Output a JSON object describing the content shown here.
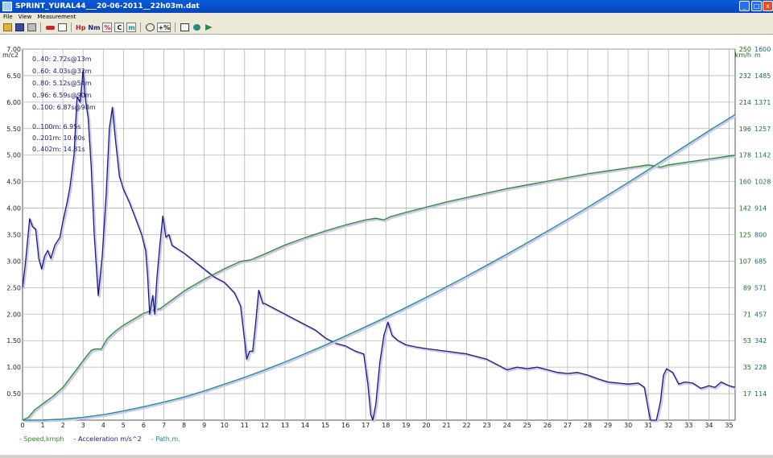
{
  "window": {
    "title": "SPRINT_YURAL44___20-06-2011__22h03m.dat",
    "min_glyph": "_",
    "max_glyph": "□",
    "close_glyph": "x"
  },
  "menu": {
    "file": "File",
    "view": "View",
    "measurement": "Measurement"
  },
  "toolbar": {
    "hp": "Hp",
    "nm": "Nm",
    "percent": "%",
    "c": "C",
    "m": "m",
    "plus_percent": "+%"
  },
  "chart_data": {
    "type": "line",
    "x_ticks": [
      0,
      1,
      2,
      3,
      4,
      5,
      6,
      7,
      8,
      9,
      10,
      11,
      12,
      13,
      14,
      15,
      16,
      17,
      18,
      19,
      20,
      21,
      22,
      23,
      24,
      25,
      26,
      27,
      28,
      29,
      30,
      31,
      32,
      33,
      34,
      35
    ],
    "xlim": [
      0,
      35.3
    ],
    "left_axis": {
      "unit": "m/c2",
      "ylim": [
        0,
        7.0
      ],
      "ticks": [
        "0.50",
        "1.00",
        "1.50",
        "2.00",
        "2.50",
        "3.00",
        "3.50",
        "4.00",
        "4.50",
        "5.00",
        "5.50",
        "6.00",
        "6.50",
        "7.00"
      ]
    },
    "speed_axis": {
      "unit": "km/h",
      "ylim": [
        0,
        250
      ],
      "ticks": [
        {
          "v": 17.857,
          "label": "17"
        },
        {
          "v": 35.714,
          "label": "35"
        },
        {
          "v": 53.571,
          "label": "53"
        },
        {
          "v": 71.429,
          "label": "71"
        },
        {
          "v": 89.286,
          "label": "89"
        },
        {
          "v": 107.143,
          "label": "107"
        },
        {
          "v": 125,
          "label": "125"
        },
        {
          "v": 142.857,
          "label": "142"
        },
        {
          "v": 160.714,
          "label": "160"
        },
        {
          "v": 178.571,
          "label": "178"
        },
        {
          "v": 196.429,
          "label": "196"
        },
        {
          "v": 214.286,
          "label": "214"
        },
        {
          "v": 232.143,
          "label": "232"
        },
        {
          "v": 250,
          "label": "250"
        }
      ]
    },
    "path_axis": {
      "unit": "m",
      "ylim": [
        0,
        1600
      ],
      "ticks": [
        {
          "v": 114.3,
          "label": "114"
        },
        {
          "v": 228.6,
          "label": "228"
        },
        {
          "v": 342.9,
          "label": "342"
        },
        {
          "v": 457.1,
          "label": "457"
        },
        {
          "v": 571.4,
          "label": "571"
        },
        {
          "v": 685.7,
          "label": "685"
        },
        {
          "v": 800,
          "label": "800"
        },
        {
          "v": 914.3,
          "label": "914"
        },
        {
          "v": 1028.6,
          "label": "1028"
        },
        {
          "v": 1142.9,
          "label": "1142"
        },
        {
          "v": 1257.1,
          "label": "1257"
        },
        {
          "v": 1371.4,
          "label": "1371"
        },
        {
          "v": 1485.7,
          "label": "1485"
        },
        {
          "v": 1600,
          "label": "1600"
        }
      ]
    },
    "annotations": [
      "0..40: 2.72s@13m",
      "0..60: 4.03s@32m",
      "0..80: 5.12s@54m",
      "0..96: 6.59s@90m",
      "0..100: 6.87s@98m",
      "0..100m: 6.95s",
      "0..201m: 10.00s",
      "0..402m: 14.81s"
    ],
    "series": [
      {
        "name": "Speed,kmph",
        "axis": "speed",
        "color": "#2e8b22",
        "points": [
          [
            0,
            0
          ],
          [
            0.3,
            2
          ],
          [
            0.6,
            7
          ],
          [
            1,
            11
          ],
          [
            1.5,
            16
          ],
          [
            2,
            22
          ],
          [
            2.5,
            31
          ],
          [
            3,
            40
          ],
          [
            3.4,
            47
          ],
          [
            3.6,
            48
          ],
          [
            3.9,
            48
          ],
          [
            4.2,
            55
          ],
          [
            4.6,
            60
          ],
          [
            5,
            64
          ],
          [
            5.5,
            68
          ],
          [
            6,
            72
          ],
          [
            6.4,
            74
          ],
          [
            6.8,
            75
          ],
          [
            7,
            77
          ],
          [
            7.5,
            82
          ],
          [
            8,
            87
          ],
          [
            9,
            95
          ],
          [
            10,
            102
          ],
          [
            10.8,
            107
          ],
          [
            11.3,
            108
          ],
          [
            12,
            112
          ],
          [
            13,
            118
          ],
          [
            14,
            123
          ],
          [
            15,
            127.5
          ],
          [
            16,
            131.5
          ],
          [
            17,
            135
          ],
          [
            17.5,
            136
          ],
          [
            17.9,
            135
          ],
          [
            18.2,
            137
          ],
          [
            19,
            140
          ],
          [
            20,
            143.5
          ],
          [
            21,
            147
          ],
          [
            22,
            150
          ],
          [
            23,
            153
          ],
          [
            24,
            156
          ],
          [
            25,
            158.5
          ],
          [
            26,
            161
          ],
          [
            27,
            163.5
          ],
          [
            28,
            166
          ],
          [
            29,
            168
          ],
          [
            30,
            170
          ],
          [
            31,
            172
          ],
          [
            31.6,
            170.5
          ],
          [
            32,
            172
          ],
          [
            33,
            174
          ],
          [
            34,
            176
          ],
          [
            35,
            178
          ],
          [
            35.3,
            178.5
          ]
        ]
      },
      {
        "name": "Acceleration m/s^2",
        "axis": "left",
        "color": "#1c1c6e",
        "points": [
          [
            0,
            2.5
          ],
          [
            0.15,
            3.0
          ],
          [
            0.35,
            3.8
          ],
          [
            0.5,
            3.65
          ],
          [
            0.65,
            3.6
          ],
          [
            0.8,
            3.05
          ],
          [
            0.95,
            2.85
          ],
          [
            1.1,
            3.1
          ],
          [
            1.25,
            3.2
          ],
          [
            1.4,
            3.05
          ],
          [
            1.6,
            3.3
          ],
          [
            1.85,
            3.45
          ],
          [
            2,
            3.75
          ],
          [
            2.2,
            4.1
          ],
          [
            2.35,
            4.4
          ],
          [
            2.55,
            5.0
          ],
          [
            2.7,
            6.1
          ],
          [
            2.85,
            6.0
          ],
          [
            3.0,
            6.6
          ],
          [
            3.1,
            6.1
          ],
          [
            3.25,
            5.7
          ],
          [
            3.4,
            4.8
          ],
          [
            3.55,
            3.5
          ],
          [
            3.75,
            2.35
          ],
          [
            3.95,
            3.1
          ],
          [
            4.15,
            4.3
          ],
          [
            4.3,
            5.5
          ],
          [
            4.45,
            5.9
          ],
          [
            4.6,
            5.3
          ],
          [
            4.8,
            4.6
          ],
          [
            5.0,
            4.35
          ],
          [
            5.3,
            4.1
          ],
          [
            5.6,
            3.8
          ],
          [
            5.9,
            3.5
          ],
          [
            6.1,
            3.2
          ],
          [
            6.2,
            2.7
          ],
          [
            6.3,
            2.0
          ],
          [
            6.45,
            2.35
          ],
          [
            6.55,
            2.0
          ],
          [
            6.65,
            2.65
          ],
          [
            6.8,
            3.3
          ],
          [
            6.95,
            3.85
          ],
          [
            7.1,
            3.45
          ],
          [
            7.25,
            3.5
          ],
          [
            7.4,
            3.3
          ],
          [
            7.6,
            3.25
          ],
          [
            8,
            3.15
          ],
          [
            8.5,
            3.0
          ],
          [
            9,
            2.85
          ],
          [
            9.5,
            2.7
          ],
          [
            10,
            2.6
          ],
          [
            10.5,
            2.4
          ],
          [
            10.8,
            2.15
          ],
          [
            11.0,
            1.5
          ],
          [
            11.1,
            1.15
          ],
          [
            11.25,
            1.3
          ],
          [
            11.4,
            1.3
          ],
          [
            11.55,
            1.85
          ],
          [
            11.7,
            2.45
          ],
          [
            11.9,
            2.2
          ],
          [
            12,
            2.2
          ],
          [
            13,
            2.0
          ],
          [
            13.5,
            1.9
          ],
          [
            14,
            1.8
          ],
          [
            14.5,
            1.7
          ],
          [
            15,
            1.55
          ],
          [
            15.5,
            1.45
          ],
          [
            16,
            1.4
          ],
          [
            16.5,
            1.3
          ],
          [
            16.9,
            1.25
          ],
          [
            17.1,
            0.7
          ],
          [
            17.25,
            0.1
          ],
          [
            17.35,
            0.0
          ],
          [
            17.5,
            0.3
          ],
          [
            17.7,
            1.1
          ],
          [
            17.9,
            1.6
          ],
          [
            18.1,
            1.85
          ],
          [
            18.3,
            1.6
          ],
          [
            18.6,
            1.5
          ],
          [
            19,
            1.42
          ],
          [
            19.5,
            1.38
          ],
          [
            20,
            1.35
          ],
          [
            21,
            1.3
          ],
          [
            22,
            1.25
          ],
          [
            22.5,
            1.2
          ],
          [
            23,
            1.15
          ],
          [
            23.5,
            1.05
          ],
          [
            24,
            0.95
          ],
          [
            24.5,
            1.0
          ],
          [
            25,
            0.97
          ],
          [
            25.5,
            1.0
          ],
          [
            26,
            0.95
          ],
          [
            26.5,
            0.9
          ],
          [
            27,
            0.88
          ],
          [
            27.5,
            0.9
          ],
          [
            28,
            0.85
          ],
          [
            28.5,
            0.78
          ],
          [
            29,
            0.72
          ],
          [
            29.5,
            0.7
          ],
          [
            30,
            0.68
          ],
          [
            30.5,
            0.7
          ],
          [
            30.8,
            0.62
          ],
          [
            31.0,
            0.2
          ],
          [
            31.1,
            0.0
          ],
          [
            31.4,
            0.0
          ],
          [
            31.6,
            0.35
          ],
          [
            31.75,
            0.85
          ],
          [
            31.9,
            0.97
          ],
          [
            32.2,
            0.9
          ],
          [
            32.5,
            0.68
          ],
          [
            32.8,
            0.72
          ],
          [
            33.2,
            0.7
          ],
          [
            33.6,
            0.6
          ],
          [
            34,
            0.65
          ],
          [
            34.3,
            0.62
          ],
          [
            34.6,
            0.72
          ],
          [
            35,
            0.65
          ],
          [
            35.3,
            0.62
          ]
        ]
      },
      {
        "name": "Path,m.",
        "axis": "path",
        "color": "#1b8a8a",
        "points": [
          [
            0,
            0
          ],
          [
            1,
            0.8
          ],
          [
            2,
            4.5
          ],
          [
            3,
            12
          ],
          [
            4,
            24
          ],
          [
            5,
            40
          ],
          [
            6,
            58
          ],
          [
            7,
            78
          ],
          [
            8,
            100
          ],
          [
            9,
            126
          ],
          [
            10,
            155
          ],
          [
            11,
            185
          ],
          [
            12,
            217
          ],
          [
            13,
            251
          ],
          [
            14,
            287
          ],
          [
            15,
            324
          ],
          [
            16,
            363
          ],
          [
            17,
            403
          ],
          [
            18,
            444
          ],
          [
            19,
            486
          ],
          [
            20,
            530
          ],
          [
            21,
            575
          ],
          [
            22,
            621
          ],
          [
            23,
            668
          ],
          [
            24,
            716
          ],
          [
            25,
            765
          ],
          [
            26,
            815
          ],
          [
            27,
            866
          ],
          [
            28,
            918
          ],
          [
            29,
            971
          ],
          [
            30,
            1025
          ],
          [
            31,
            1080
          ],
          [
            32,
            1136
          ],
          [
            33,
            1192
          ],
          [
            34,
            1248
          ],
          [
            35,
            1302
          ],
          [
            35.3,
            1318
          ]
        ]
      }
    ]
  }
}
